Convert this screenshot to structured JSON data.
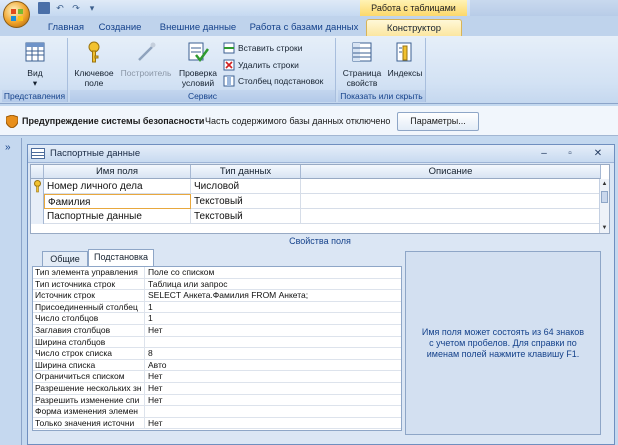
{
  "window": {
    "context_title": "Работа с таблицами"
  },
  "ribbon_tabs": [
    {
      "label": "Главная"
    },
    {
      "label": "Создание"
    },
    {
      "label": "Внешние данные"
    },
    {
      "label": "Работа с базами данных"
    },
    {
      "label": "Конструктор",
      "active": true
    }
  ],
  "ribbon": {
    "view_label": "Вид",
    "group_views_label": "Представления",
    "key_field_label": "Ключевое поле",
    "builder_label": "Построитель",
    "check_conditions_label": "Проверка условий",
    "insert_rows_label": "Вставить строки",
    "delete_rows_label": "Удалить строки",
    "lookup_column_label": "Столбец подстановок",
    "group_service_label": "Сервис",
    "property_sheet_label": "Страница свойств",
    "indexes_label": "Индексы",
    "group_show_hide_label": "Показать или скрыть"
  },
  "security_bar": {
    "title": "Предупреждение системы безопасности",
    "message": "Часть содержимого базы данных отключено",
    "button_label": "Параметры..."
  },
  "document": {
    "title": "Паспортные данные",
    "columns": [
      "Имя поля",
      "Тип данных",
      "Описание"
    ],
    "rows": [
      {
        "name": "Номер личного дела",
        "type": "Числовой",
        "key": true
      },
      {
        "name": "Фамилия",
        "type": "Текстовый",
        "selected": true
      },
      {
        "name": "Паспортные данные",
        "type": "Текстовый"
      }
    ],
    "field_properties_label": "Свойства поля"
  },
  "property_tabs": [
    {
      "label": "Общие"
    },
    {
      "label": "Подстановка",
      "active": true
    }
  ],
  "properties": [
    {
      "name": "Тип элемента управления",
      "value": "Поле со списком"
    },
    {
      "name": "Тип источника строк",
      "value": "Таблица или запрос"
    },
    {
      "name": "Источник строк",
      "value": "SELECT Анкета.Фамилия FROM Анкета;"
    },
    {
      "name": "Присоединенный столбец",
      "value": "1"
    },
    {
      "name": "Число столбцов",
      "value": "1"
    },
    {
      "name": "Заглавия столбцов",
      "value": "Нет"
    },
    {
      "name": "Ширина столбцов",
      "value": ""
    },
    {
      "name": "Число строк списка",
      "value": "8"
    },
    {
      "name": "Ширина списка",
      "value": "Авто"
    },
    {
      "name": "Ограничиться списком",
      "value": "Нет"
    },
    {
      "name": "Разрешение нескольких зн",
      "value": "Нет"
    },
    {
      "name": "Разрешить изменение спи",
      "value": "Нет"
    },
    {
      "name": "Форма изменения элемен",
      "value": ""
    },
    {
      "name": "Только значения источни",
      "value": "Нет"
    }
  ],
  "help_text": "Имя поля может состоять из 64 знаков с учетом пробелов.  Для справки по именам полей нажмите клавишу F1."
}
